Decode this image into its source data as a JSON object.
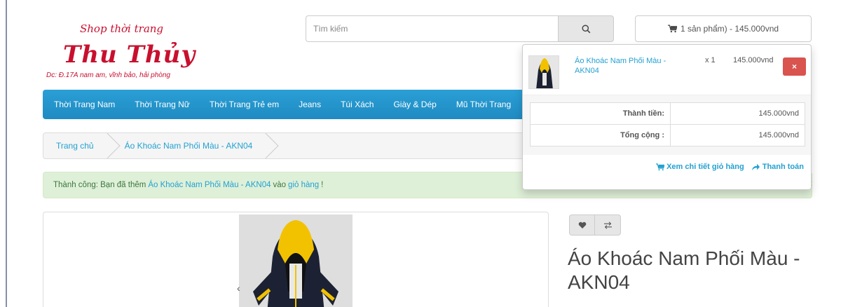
{
  "logo": {
    "small": "Shop thời trang",
    "big": "Thu Thủy",
    "address": "Dc:  Đ.17A nam am, vĩnh bảo, hải phòng"
  },
  "search": {
    "placeholder": "Tìm kiếm"
  },
  "cart": {
    "summary": "1 sản phẩm) - 145.000vnd",
    "item": {
      "name": "Áo Khoác Nam Phối Màu - AKN04",
      "qty": "x 1",
      "price": "145.000vnd",
      "remove_label": "×"
    },
    "totals": [
      {
        "label": "Thành tiền:",
        "value": "145.000vnd"
      },
      {
        "label": "Tổng cộng :",
        "value": "145.000vnd"
      }
    ],
    "view_cart": "Xem chi tiết giỏ hàng",
    "checkout": "Thanh toán"
  },
  "menu": {
    "items": [
      "Thời Trang Nam",
      "Thời Trang Nữ",
      "Thời Trang Trẻ em",
      "Jeans",
      "Túi Xách",
      "Giày & Dép",
      "Mũ Thời Trang"
    ]
  },
  "breadcrumb": {
    "items": [
      "Trang chủ",
      "Áo Khoác Nam Phối Màu - AKN04"
    ]
  },
  "alert": {
    "prefix": "Thành công: Bạn đã thêm",
    "product_link": "Áo Khoác Nam Phối Màu - AKN04",
    "middle": "vào",
    "cart_link": "giỏ hàng",
    "suffix": "!",
    "close": "×"
  },
  "product": {
    "title": "Áo Khoác Nam Phối Màu - AKN04"
  },
  "colors": {
    "brand_red": "#c8102e",
    "menu_blue": "#2a9fd6",
    "link_blue": "#23a1d1",
    "danger": "#d9534f",
    "success_bg": "#dff0d8"
  }
}
